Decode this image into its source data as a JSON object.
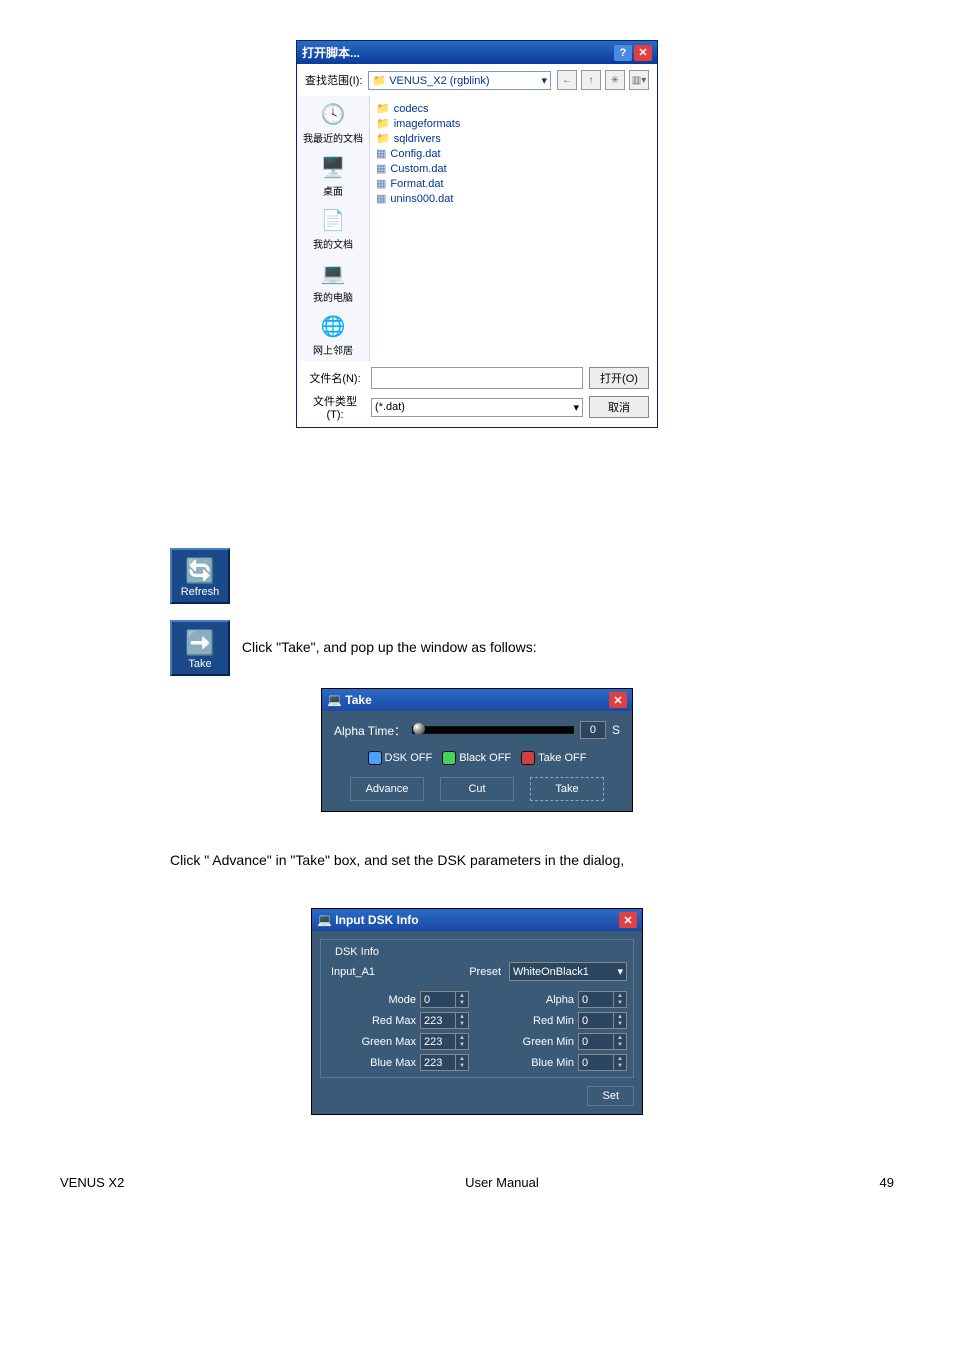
{
  "file_open": {
    "title": "打开脚本...",
    "lookin_label": "查找范围(I):",
    "lookin_value": "VENUS_X2 (rgblink)",
    "sidebar": [
      {
        "label": "我最近的文档",
        "icon": "🕓"
      },
      {
        "label": "桌面",
        "icon": "🖥️"
      },
      {
        "label": "我的文档",
        "icon": "📄"
      },
      {
        "label": "我的电脑",
        "icon": "💻"
      },
      {
        "label": "网上邻居",
        "icon": "🌐"
      }
    ],
    "items": [
      {
        "name": "codecs",
        "type": "folder"
      },
      {
        "name": "imageformats",
        "type": "folder"
      },
      {
        "name": "sqldrivers",
        "type": "folder"
      },
      {
        "name": "Config.dat",
        "type": "file"
      },
      {
        "name": "Custom.dat",
        "type": "file"
      },
      {
        "name": "Format.dat",
        "type": "file"
      },
      {
        "name": "unins000.dat",
        "type": "file"
      }
    ],
    "filename_label": "文件名(N):",
    "filetype_label": "文件类型(T):",
    "filetype_value": "(*.dat)",
    "open_btn": "打开(O)",
    "cancel_btn": "取消"
  },
  "toolbuttons": {
    "refresh": "Refresh",
    "take": "Take"
  },
  "text1": "Click \"Take\", and pop up the window as follows:",
  "take_window": {
    "title": "Take",
    "alpha_label": "Alpha Time：",
    "alpha_value": "0",
    "alpha_unit": "S",
    "toggles": [
      "DSK OFF",
      "Black OFF",
      "Take OFF"
    ],
    "buttons": [
      "Advance",
      "Cut",
      "Take"
    ]
  },
  "text2": "Click \" Advance\" in \"Take\" box, and set the DSK parameters in the dialog,",
  "dsk_window": {
    "title": "Input DSK Info",
    "group_title": "DSK Info",
    "input_label": "Input_A1",
    "preset_label": "Preset",
    "preset_value": "WhiteOnBlack1",
    "params": [
      {
        "label": "Mode",
        "value": "0"
      },
      {
        "label": "Alpha",
        "value": "0"
      },
      {
        "label": "Red Max",
        "value": "223"
      },
      {
        "label": "Red Min",
        "value": "0"
      },
      {
        "label": "Green Max",
        "value": "223"
      },
      {
        "label": "Green Min",
        "value": "0"
      },
      {
        "label": "Blue Max",
        "value": "223"
      },
      {
        "label": "Blue Min",
        "value": "0"
      }
    ],
    "set_btn": "Set"
  },
  "footer": {
    "left": "VENUS X2",
    "center": "User Manual",
    "right": "49"
  }
}
